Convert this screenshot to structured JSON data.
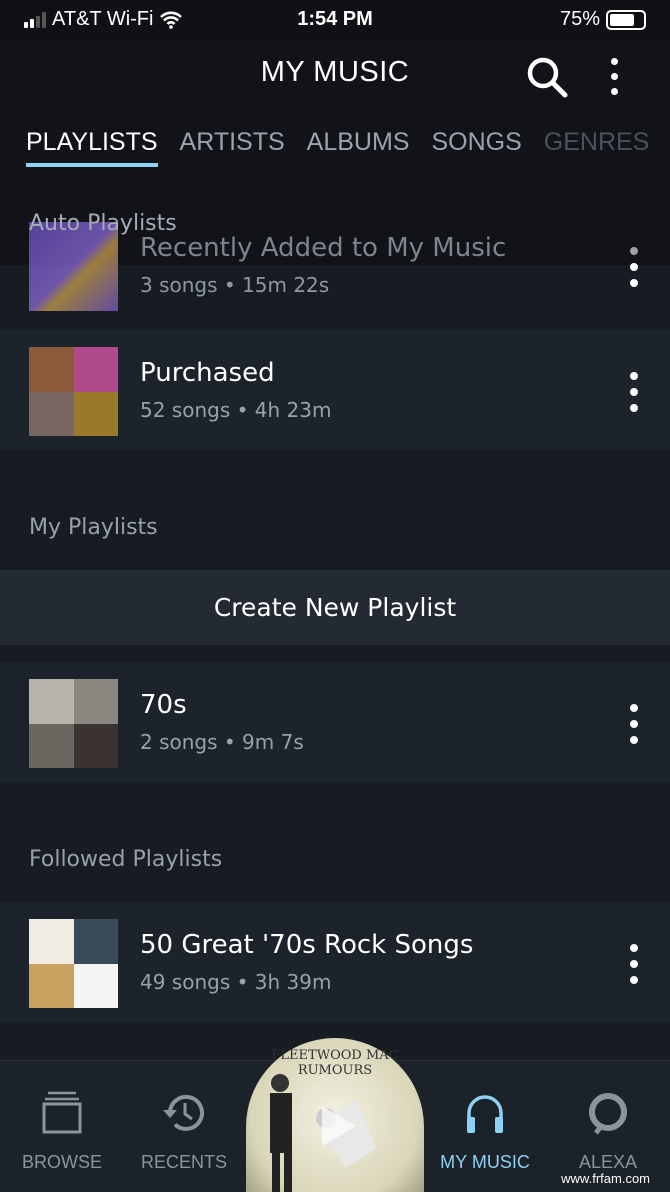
{
  "status": {
    "carrier": "AT&T Wi-Fi",
    "time": "1:54 PM",
    "battery": "75%",
    "battery_level": 0.75
  },
  "header": {
    "title": "MY MUSIC"
  },
  "tabs": [
    {
      "label": "PLAYLISTS",
      "active": true
    },
    {
      "label": "ARTISTS"
    },
    {
      "label": "ALBUMS"
    },
    {
      "label": "SONGS"
    },
    {
      "label": "GENRES"
    }
  ],
  "sections": {
    "auto": "Auto Playlists",
    "mine": "My Playlists",
    "followed": "Followed Playlists"
  },
  "auto_playlists": [
    {
      "name": "Recently Added to My Music",
      "details": "3 songs • 15m 22s"
    },
    {
      "name": "Purchased",
      "details": "52 songs • 4h 23m"
    }
  ],
  "create_label": "Create New Playlist",
  "my_playlists": [
    {
      "name": "70s",
      "details": "2 songs • 9m 7s"
    }
  ],
  "followed_playlists": [
    {
      "name": "50 Great '70s Rock Songs",
      "details": "49 songs • 3h 39m"
    }
  ],
  "nav": {
    "browse": "BROWSE",
    "recents": "RECENTS",
    "my_music": "MY MUSIC",
    "alexa": "ALEXA"
  },
  "now_playing": {
    "art_text": "FLEETWOOD MAC RUMOURS"
  },
  "watermark": "www.frfam.com",
  "colors": {
    "accent": "#8ed2f3",
    "background": "#171c23"
  }
}
